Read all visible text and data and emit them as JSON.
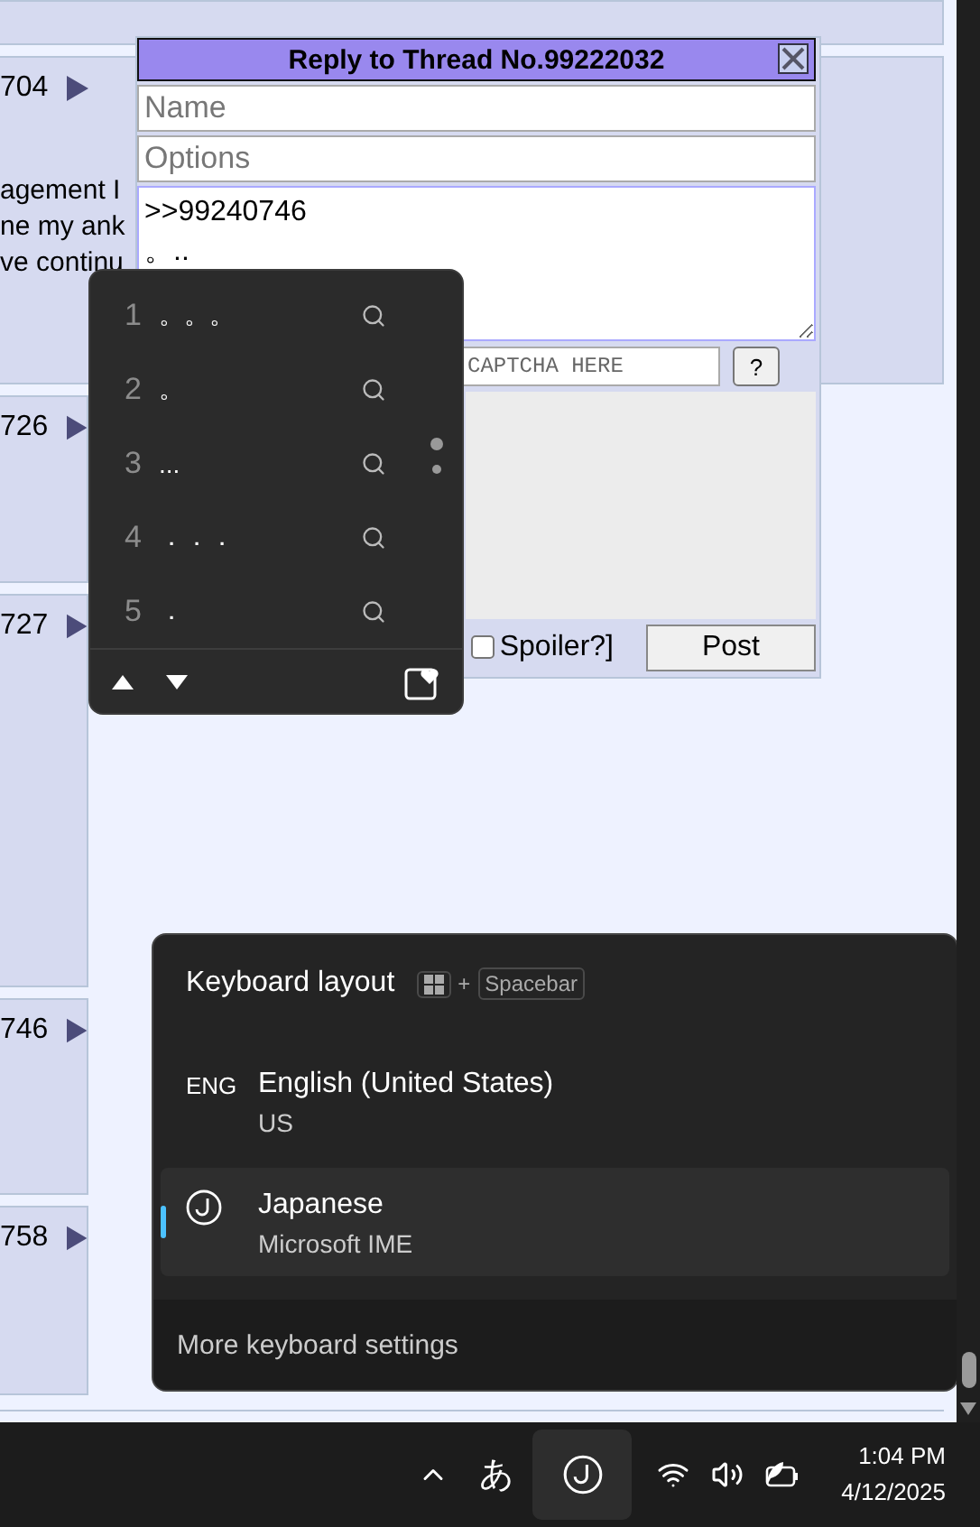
{
  "posts": [
    {
      "number": "704",
      "lines": [
        "agement I",
        "ne my ank",
        "ve continu"
      ]
    },
    {
      "number": "726"
    },
    {
      "number": "727"
    },
    {
      "number": "746"
    },
    {
      "number": "758"
    }
  ],
  "reply_form": {
    "title": "Reply to Thread No.99222032",
    "name": {
      "placeholder": "Name"
    },
    "options": {
      "placeholder": "Options"
    },
    "comment": {
      "value": ">>99240746\n。.."
    },
    "captcha": {
      "placeholder": "CAPTCHA HERE"
    },
    "help_button": "?",
    "spoiler": {
      "label": "Spoiler?]",
      "checked": false
    },
    "post_button": "Post"
  },
  "ime_candidates": {
    "items": [
      {
        "number": "1",
        "text": "。。。"
      },
      {
        "number": "2",
        "text": "。"
      },
      {
        "number": "3",
        "text": "..."
      },
      {
        "number": "4",
        "text": "．．．"
      },
      {
        "number": "5",
        "text": "．"
      }
    ]
  },
  "keyboard_layout": {
    "title": "Keyboard layout",
    "shortcut_plus": "+",
    "shortcut_key": "Spacebar",
    "layouts": [
      {
        "kind": "tag",
        "tag": "ENG",
        "name": "English (United States)",
        "detail": "US",
        "selected": false
      },
      {
        "kind": "ime",
        "name": "Japanese",
        "detail": "Microsoft IME",
        "selected": true
      }
    ],
    "footer": "More keyboard settings"
  },
  "taskbar": {
    "input_mode": "あ",
    "time": "1:04 PM",
    "date": "4/12/2025"
  }
}
